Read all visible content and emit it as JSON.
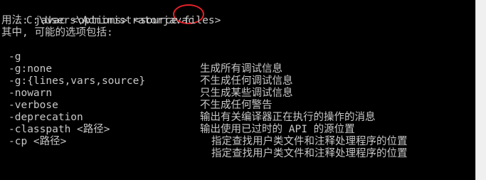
{
  "console": {
    "prompt": "C:\\Users\\Administrator",
    "command": "javac",
    "usage_line": "用法: javac <options> <source files>",
    "options_header": "其中, 可能的选项包括:",
    "options": [
      {
        "flag": "-g",
        "desc": "生成所有调试信息"
      },
      {
        "flag": "-g:none",
        "desc": "不生成任何调试信息"
      },
      {
        "flag": "-g:{lines,vars,source}",
        "desc": "只生成某些调试信息"
      },
      {
        "flag": "-nowarn",
        "desc": "不生成任何警告"
      },
      {
        "flag": "-verbose",
        "desc": "输出有关编译器正在执行的操作的消息"
      },
      {
        "flag": "-deprecation",
        "desc": "输出使用已过时的 API 的源位置"
      },
      {
        "flag": "-classpath <路径>",
        "desc": "指定查找用户类文件和注释处理程序的位置"
      },
      {
        "flag": "-cp <路径>",
        "desc": "指定查找用户类文件和注释处理程序的位置"
      }
    ],
    "annotation_color": "#e8202a",
    "background": "#000000",
    "text_color": "#c8c8c8"
  }
}
